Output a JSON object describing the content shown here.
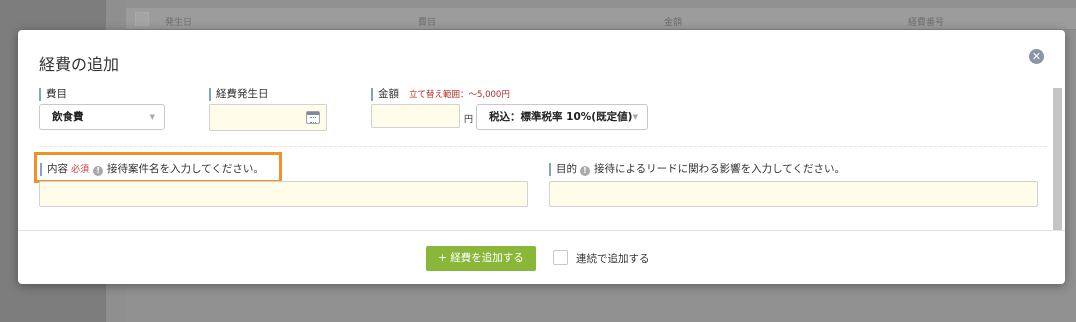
{
  "background": {
    "columns": [
      "発生日",
      "費目",
      "金額",
      "経費番号"
    ]
  },
  "modal": {
    "title": "経費の追加",
    "close_glyph": "✕",
    "fields": {
      "category": {
        "label": "費目",
        "value": "飲食費"
      },
      "date": {
        "label": "経費発生日",
        "value": ""
      },
      "amount": {
        "label": "金額",
        "note": "立て替え範囲：〜5,000円",
        "value": "",
        "unit": "円",
        "tax_select": "税込：標準税率 10%(既定値)"
      },
      "content": {
        "label": "内容",
        "required": "必須",
        "hint": "接待案件名を入力してください。",
        "value": ""
      },
      "purpose": {
        "label": "目的",
        "hint": "接待によるリードに関わる影響を入力してください。",
        "value": ""
      }
    },
    "footer": {
      "add_button": "+ 経費を追加する",
      "continuous_label": "連続で追加する"
    }
  },
  "colors": {
    "primary_button": "#89b73a",
    "highlight": "#f0922c",
    "required": "#c43a3a",
    "input_bg": "#fffde9"
  }
}
